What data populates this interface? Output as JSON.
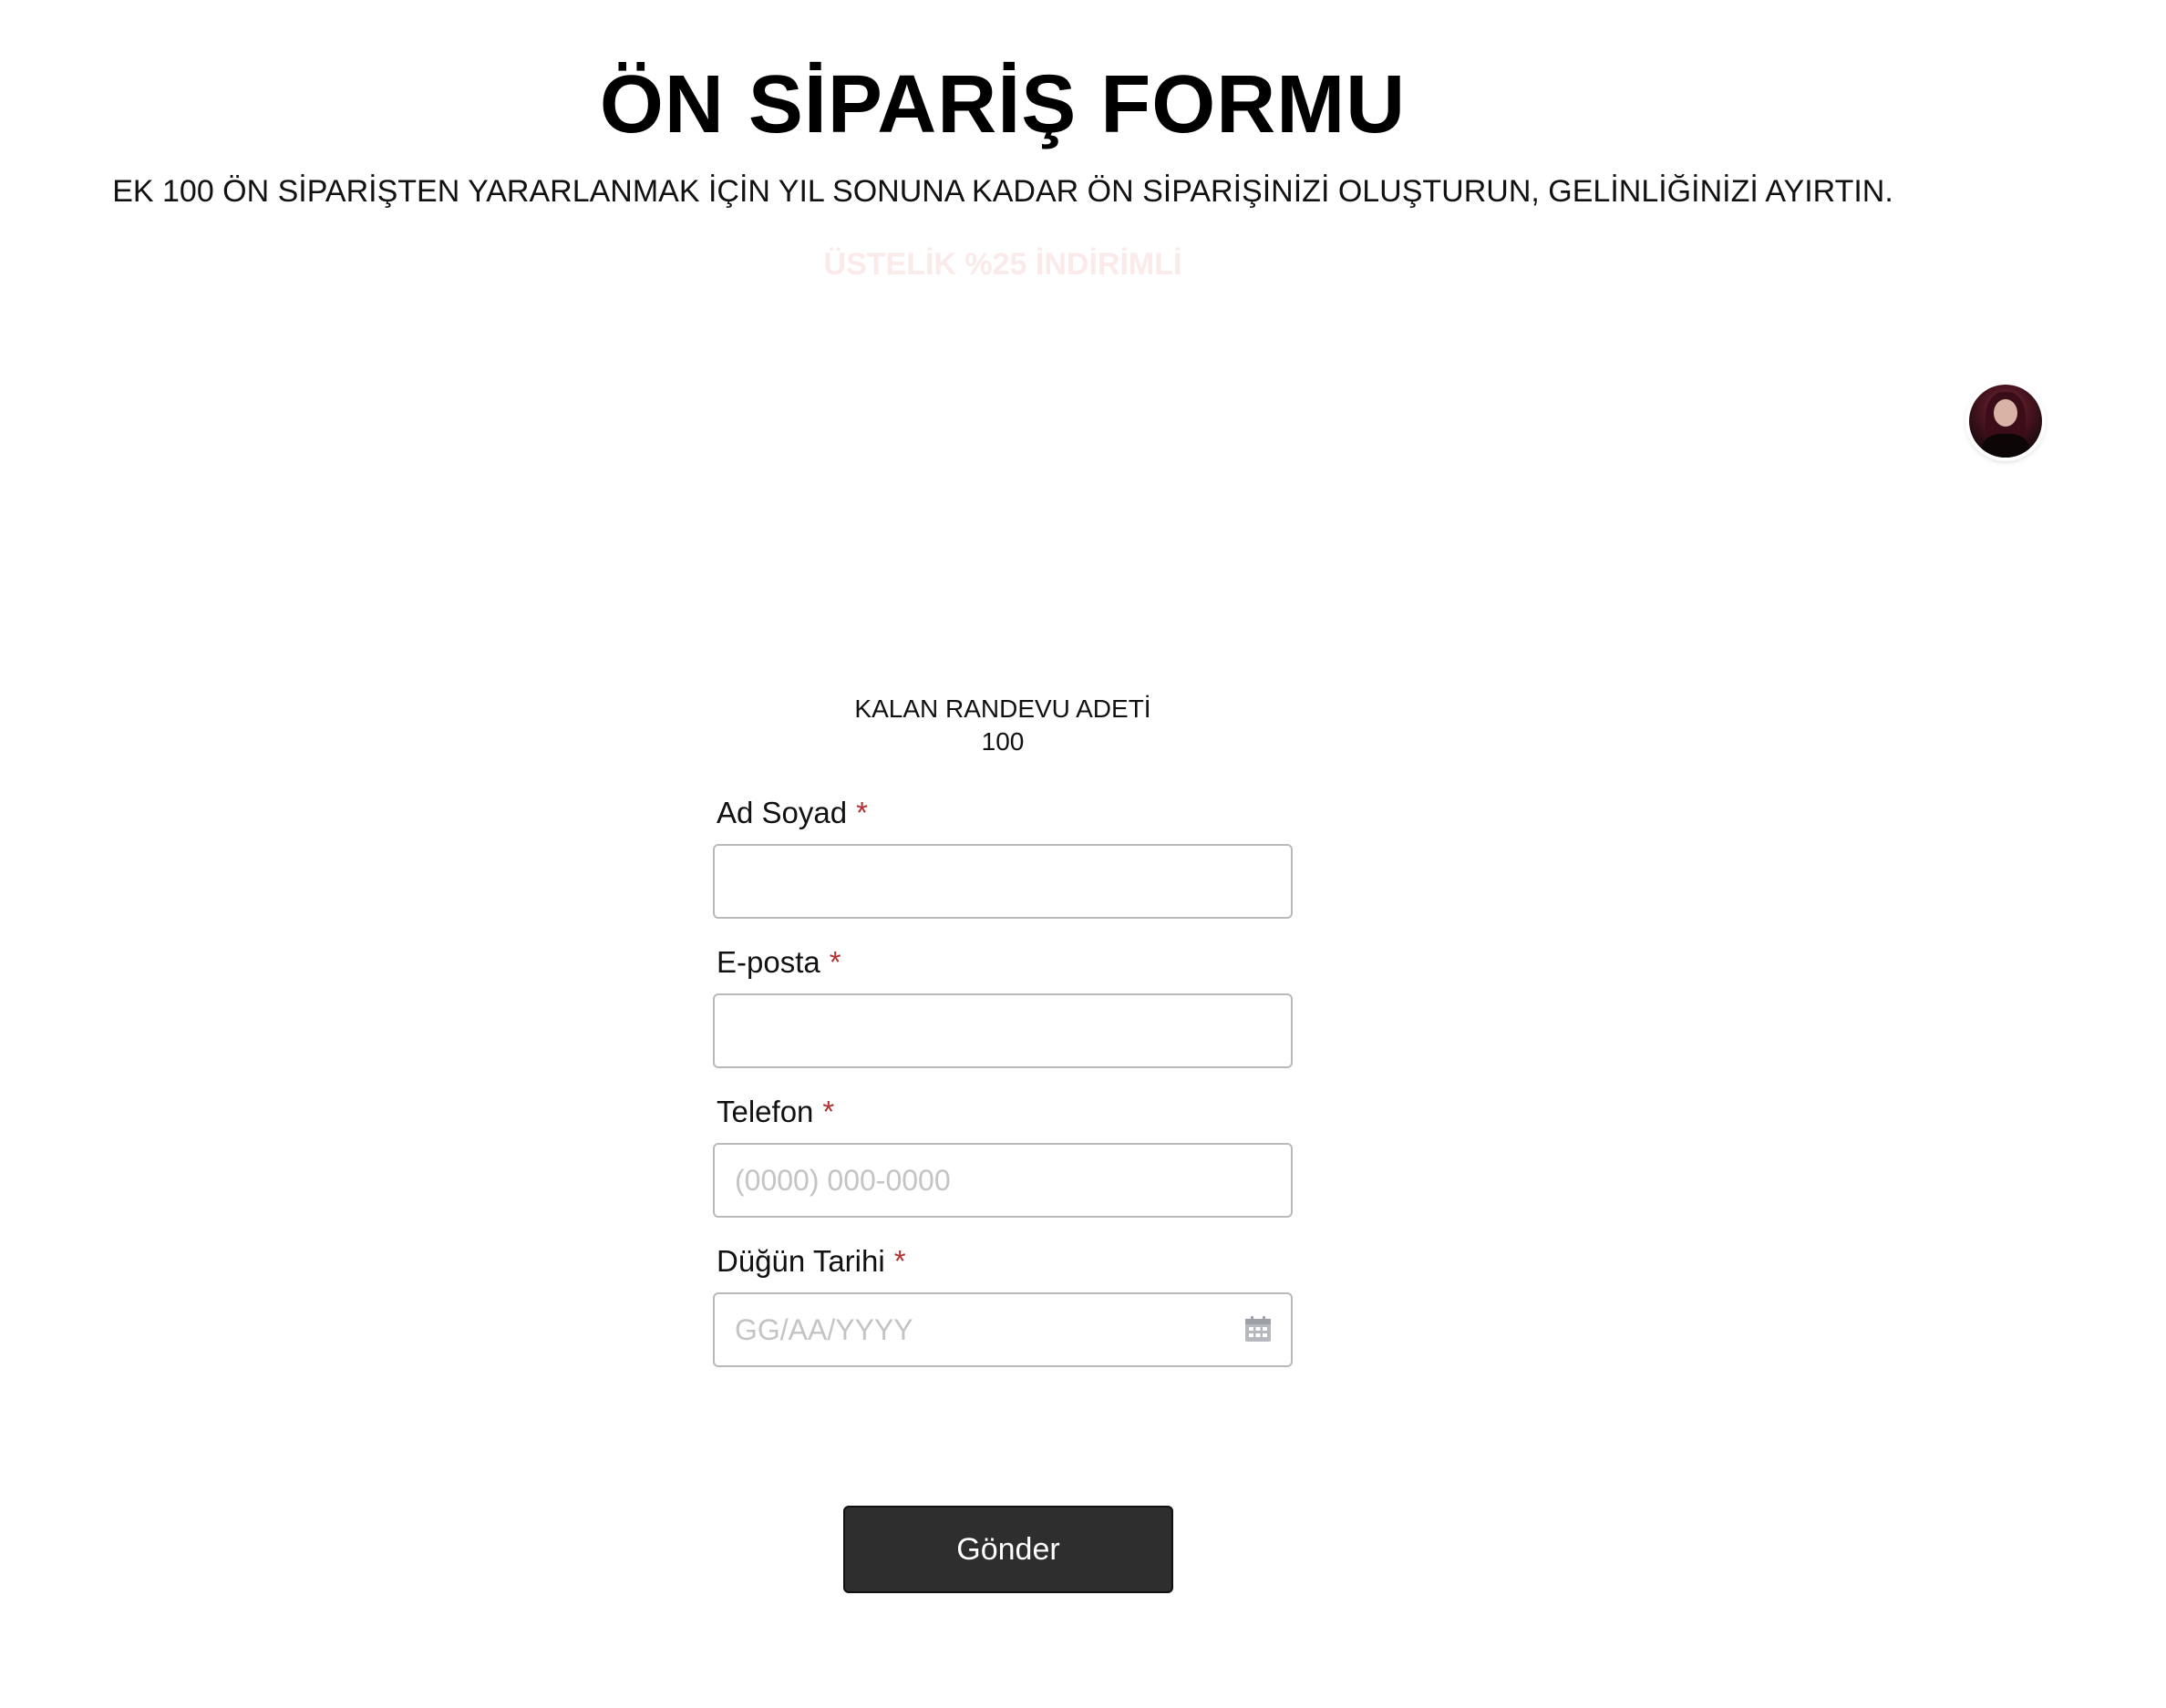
{
  "header": {
    "title": "ÖN SİPARİŞ FORMU",
    "subtitle": "EK 100 ÖN SİPARİŞTEN YARARLANMAK İÇİN YIL SONUNA KADAR ÖN SİPARİŞİNİZİ OLUŞTURUN, GELİNLİĞİNİZİ AYIRTIN.",
    "promo": "ÜSTELİK %25 İNDİRİMLİ"
  },
  "counter": {
    "label": "KALAN RANDEVU ADETİ",
    "value": "100"
  },
  "form": {
    "required_marker": "*",
    "fields": [
      {
        "label": "Ad Soyad",
        "value": "",
        "placeholder": ""
      },
      {
        "label": "E-posta",
        "value": "",
        "placeholder": ""
      },
      {
        "label": "Telefon",
        "value": "",
        "placeholder": "(0000) 000-0000"
      },
      {
        "label": "Düğün Tarihi",
        "value": "",
        "placeholder": "GG/AA/YYYY",
        "icon": "calendar-icon"
      }
    ],
    "submit_label": "Gönder"
  },
  "colors": {
    "required": "#b03030",
    "button_bg": "#2e2e2e",
    "promo_text": "#fbeaea"
  }
}
